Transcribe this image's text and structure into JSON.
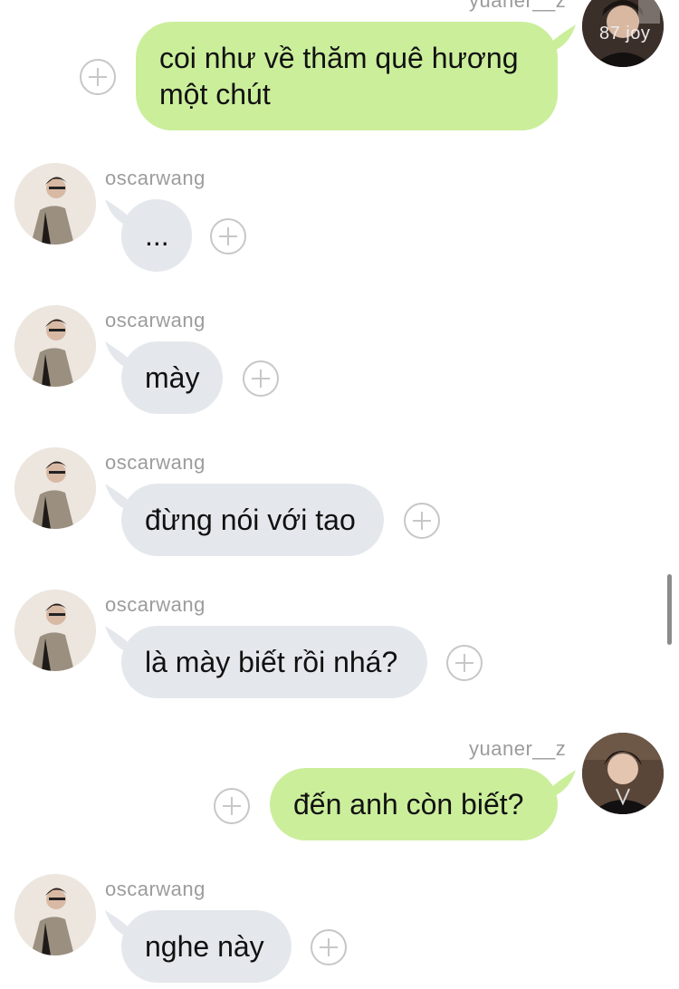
{
  "messages": [
    {
      "sender": "yuaner__z",
      "text": "coi như về thăm quê hương\nmột chút",
      "badge": "87 joy"
    },
    {
      "sender": "oscarwang",
      "text": "..."
    },
    {
      "sender": "oscarwang",
      "text": "mày"
    },
    {
      "sender": "oscarwang",
      "text": "đừng nói với tao"
    },
    {
      "sender": "oscarwang",
      "text": "là mày biết rồi nhá?"
    },
    {
      "sender": "yuaner__z",
      "text": "đến anh còn biết?"
    },
    {
      "sender": "oscarwang",
      "text": "nghe này"
    }
  ],
  "colors": {
    "incoming_bubble": "#e4e8ec",
    "outgoing_bubble": "#cbee9b",
    "username": "#9c9c9c"
  },
  "icons": [
    "add-reaction-icon",
    "avatar-oscarwang",
    "avatar-yuaner"
  ]
}
